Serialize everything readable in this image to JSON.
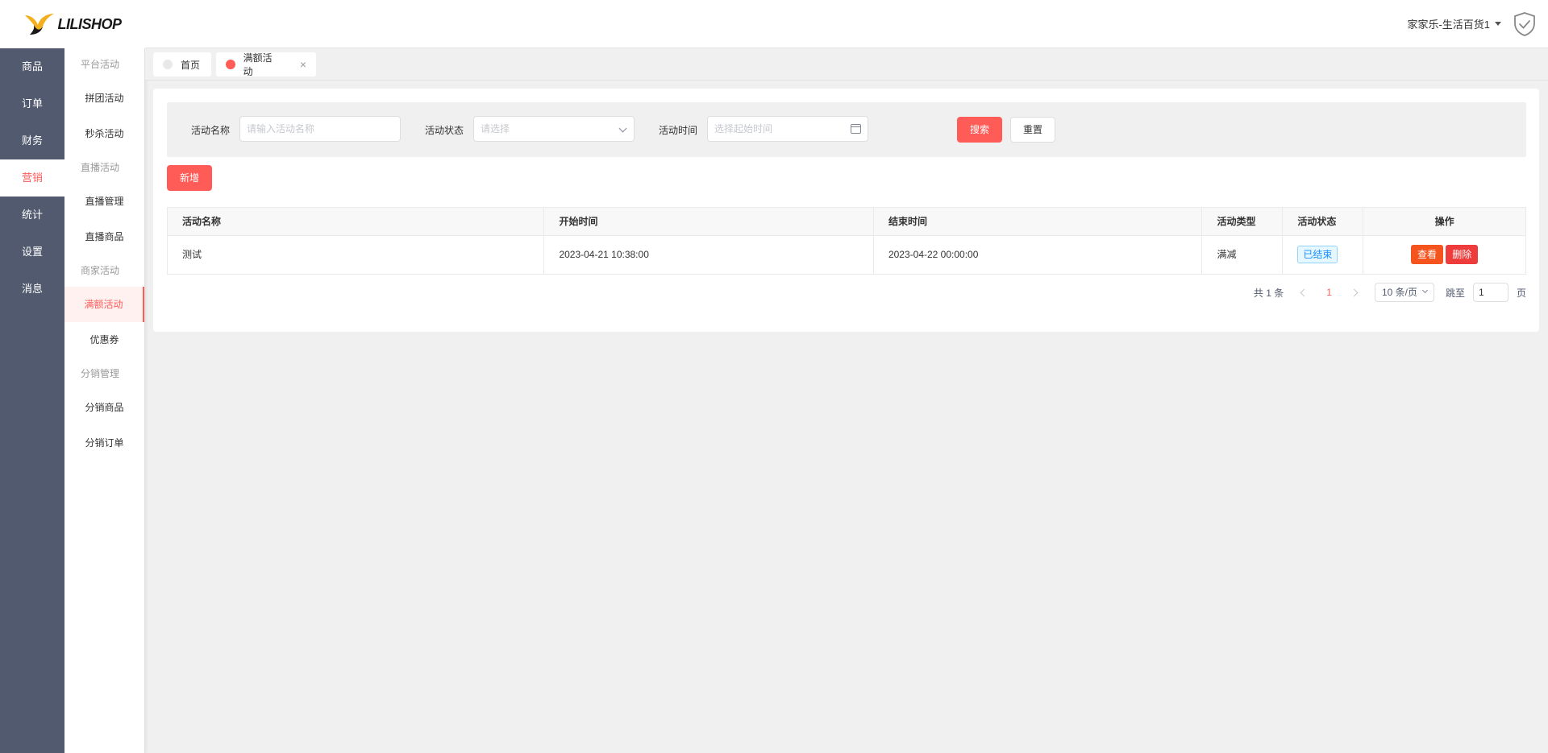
{
  "logo": {
    "text": "LILISHOP"
  },
  "primary_nav": [
    {
      "label": "商品",
      "active": false
    },
    {
      "label": "订单",
      "active": false
    },
    {
      "label": "财务",
      "active": false
    },
    {
      "label": "营销",
      "active": true
    },
    {
      "label": "统计",
      "active": false
    },
    {
      "label": "设置",
      "active": false
    },
    {
      "label": "消息",
      "active": false
    }
  ],
  "secondary_nav": {
    "group_platform": "平台活动",
    "item_pintuan": "拼团活动",
    "item_miaosha": "秒杀活动",
    "group_live": "直播活动",
    "item_live_manage": "直播管理",
    "item_live_goods": "直播商品",
    "group_merchant": "商家活动",
    "item_full_discount": "满额活动",
    "item_coupon": "优惠券",
    "group_distribution": "分销管理",
    "item_dist_goods": "分销商品",
    "item_dist_orders": "分销订单"
  },
  "header": {
    "user": "家家乐-生活百货1"
  },
  "tabs": {
    "home": "首页",
    "current": "满额活动",
    "close": "×"
  },
  "filter": {
    "name_label": "活动名称",
    "name_placeholder": "请输入活动名称",
    "status_label": "活动状态",
    "status_placeholder": "请选择",
    "time_label": "活动时间",
    "time_placeholder": "选择起始时间",
    "search_button": "搜索",
    "reset_button": "重置"
  },
  "add_button": "新增",
  "table": {
    "headers": [
      "活动名称",
      "开始时间",
      "结束时间",
      "活动类型",
      "活动状态",
      "操作"
    ],
    "rows": [
      {
        "name": "测试",
        "start": "2023-04-21 10:38:00",
        "end": "2023-04-22 00:00:00",
        "type": "满减",
        "status": "已结束",
        "view": "查看",
        "delete": "删除"
      }
    ]
  },
  "pagination": {
    "total": "共 1 条",
    "current_page": "1",
    "page_size": "10 条/页",
    "jump_label": "跳至",
    "jump_value": "1",
    "page_unit": "页"
  },
  "colors": {
    "accent": "#ff5c58",
    "view_button": "#f5541e",
    "delete_button": "#ee3b3b",
    "nav_bg": "#515a6e",
    "tab_home_dot": "#e0e0e0",
    "tab_active_dot": "#ff5c58"
  }
}
